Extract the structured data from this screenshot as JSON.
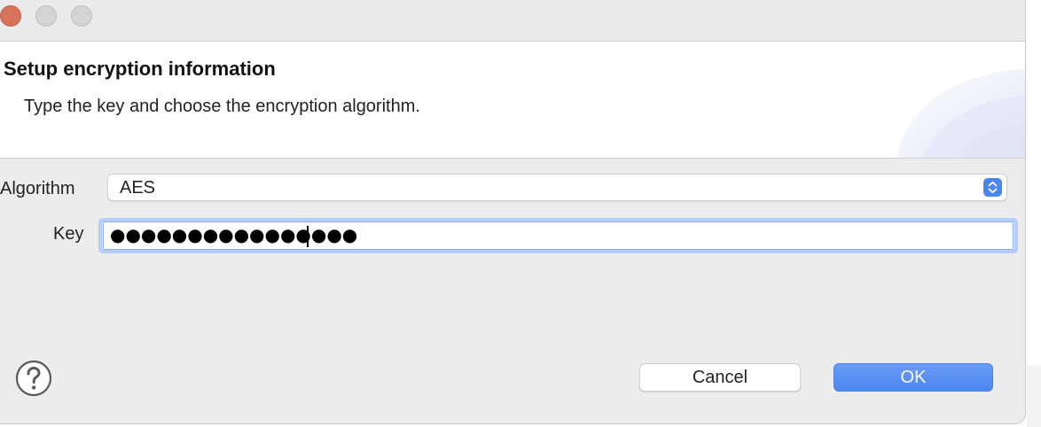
{
  "window": {
    "controls": [
      "close",
      "minimize",
      "zoom"
    ]
  },
  "header": {
    "title": "Setup encryption information",
    "description": "Type the key and choose the encryption algorithm."
  },
  "form": {
    "algorithm_label": "Algorithm",
    "algorithm_value": "AES",
    "key_label": "Key",
    "key_masked": "●●●●●●●●●●●●●●●●"
  },
  "buttons": {
    "help_icon": "question-mark-circle-icon",
    "cancel_label": "Cancel",
    "ok_label": "OK"
  },
  "colors": {
    "accent": "#4d86f0",
    "close": "#d8735b",
    "focus_ring": "#b8cdf5"
  }
}
